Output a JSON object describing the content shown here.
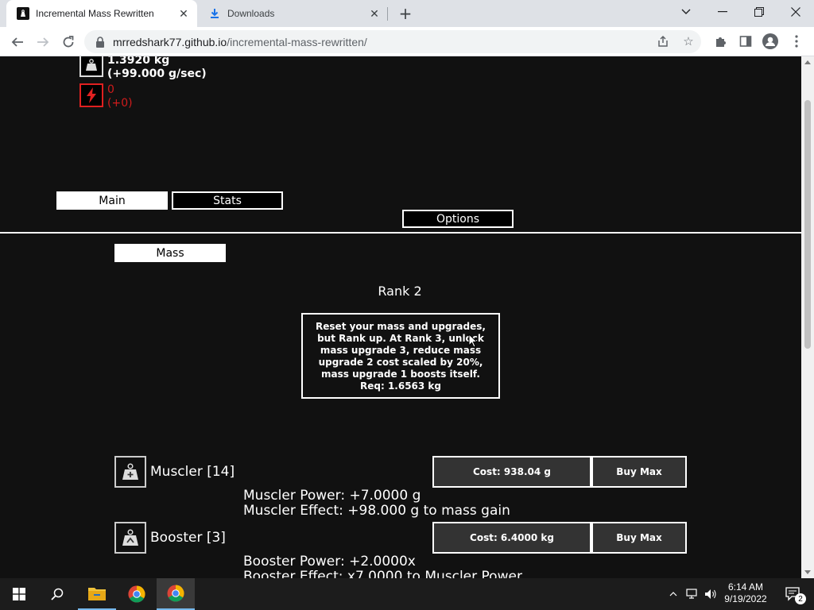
{
  "browser": {
    "tabs": [
      {
        "title": "Incremental Mass Rewritten",
        "active": true,
        "icon": "app-favicon"
      },
      {
        "title": "Downloads",
        "active": false,
        "icon": "download-icon"
      }
    ],
    "url_host": "mrredshark77.github.io",
    "url_path": "/incremental-mass-rewritten/"
  },
  "resources": {
    "mass": {
      "value": "1.3920 kg",
      "rate": "(+99.000 g/sec)",
      "icon": "weight-icon"
    },
    "energy": {
      "value": "0",
      "rate": "(+0)",
      "icon": "lightning-icon",
      "color": "#d01c1c"
    }
  },
  "nav": {
    "main": "Main",
    "stats": "Stats",
    "options": "Options"
  },
  "subtab": {
    "mass": "Mass"
  },
  "rank": {
    "title": "Rank 2",
    "lines": [
      "Reset your mass and upgrades,",
      "but Rank up. At Rank 3, unlock",
      "mass upgrade 3, reduce mass",
      "upgrade 2 cost scaled by 20%,",
      "mass upgrade 1 boosts itself.",
      "Req: 1.6563 kg"
    ]
  },
  "upgrades": [
    {
      "name": "Muscler [14]",
      "cost": "Cost: 938.04 g",
      "buy_max": "Buy Max",
      "power": "Muscler Power: +7.0000 g",
      "effect": "Muscler Effect: +98.000 g to mass gain"
    },
    {
      "name": "Booster [3]",
      "cost": "Cost: 6.4000 kg",
      "buy_max": "Buy Max",
      "power": "Booster Power: +2.0000x",
      "effect": "Booster Effect: x7.0000 to Muscler Power"
    }
  ],
  "taskbar": {
    "time": "6:14 AM",
    "date": "9/19/2022",
    "notifications": "2"
  },
  "colors": {
    "page_bg": "#111111",
    "accent_red": "#d01c1c",
    "button_bg": "#333333"
  }
}
